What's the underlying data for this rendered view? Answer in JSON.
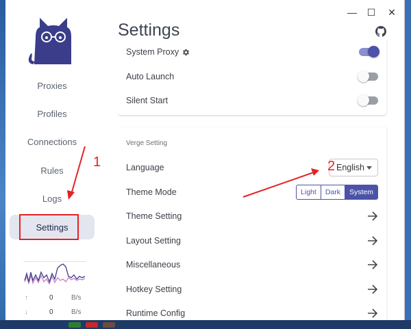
{
  "window": {
    "title": "Settings",
    "controls": {
      "minimize": "—",
      "maximize": "☐",
      "close": "✕"
    }
  },
  "sidebar": {
    "items": [
      {
        "label": "Proxies"
      },
      {
        "label": "Profiles"
      },
      {
        "label": "Connections"
      },
      {
        "label": "Rules"
      },
      {
        "label": "Logs"
      },
      {
        "label": "Settings",
        "active": true
      }
    ],
    "traffic": {
      "upload": {
        "value": "0",
        "unit": "B/s",
        "icon": "↑"
      },
      "download": {
        "value": "0",
        "unit": "B/s",
        "icon": "↓"
      }
    }
  },
  "system_card": {
    "rows": [
      {
        "label": "System Proxy",
        "icon": "gear-icon",
        "enabled": true
      },
      {
        "label": "Auto Launch",
        "enabled": false
      },
      {
        "label": "Silent Start",
        "enabled": false
      }
    ]
  },
  "verge_card": {
    "title": "Verge Setting",
    "language": {
      "label": "Language",
      "value": "English"
    },
    "theme_mode": {
      "label": "Theme Mode",
      "options": [
        "Light",
        "Dark",
        "System"
      ],
      "selected": "System"
    },
    "links": [
      "Theme Setting",
      "Layout Setting",
      "Miscellaneous",
      "Hotkey Setting",
      "Runtime Config"
    ]
  },
  "annotations": {
    "marker1": "1",
    "marker2": "2"
  },
  "colors": {
    "accent": "#4c52a8",
    "annotation": "#e32222",
    "logo": "#3b3d8a"
  }
}
